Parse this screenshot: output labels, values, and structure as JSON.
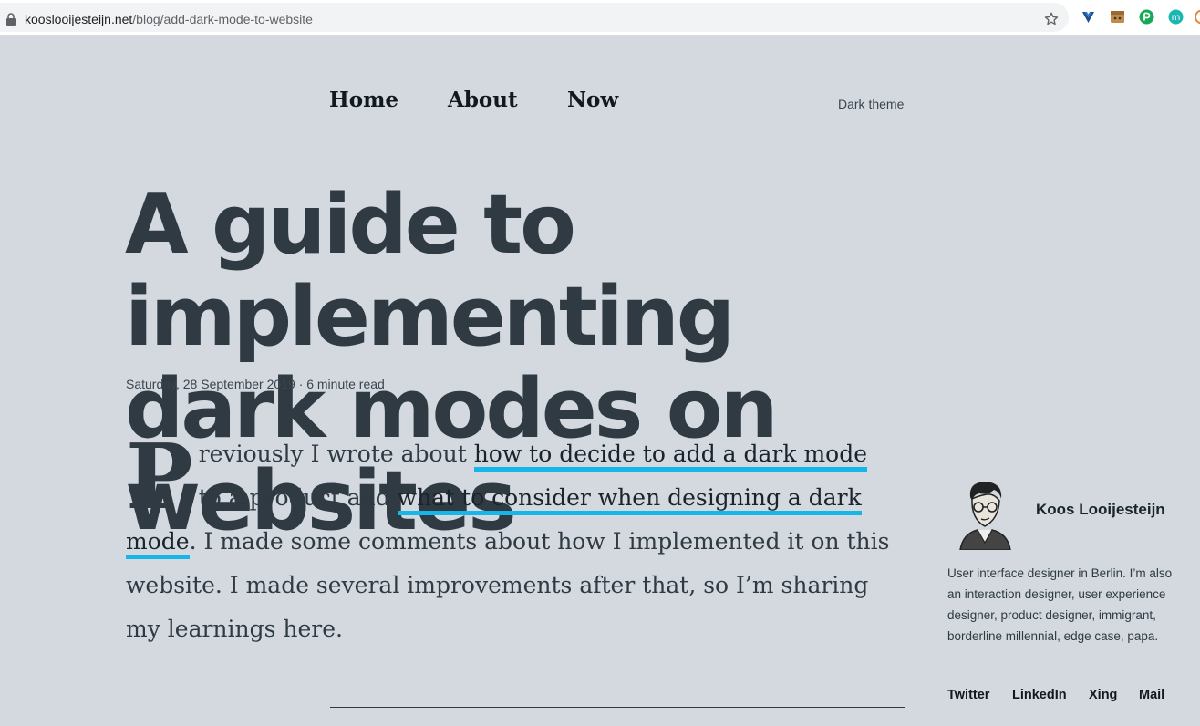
{
  "browser": {
    "url_domain": "kooslooijesteijn.net",
    "url_path": "/blog/add-dark-mode-to-website",
    "extension_icons": [
      "vue-devtools-icon",
      "box-extension-icon",
      "grammar-extension-icon",
      "m-extension-icon"
    ]
  },
  "nav": {
    "items": [
      {
        "label": "Home"
      },
      {
        "label": "About"
      },
      {
        "label": "Now"
      }
    ],
    "theme_toggle": "Dark theme"
  },
  "article": {
    "title_line1": "A guide to implementing",
    "title_line2": "dark modes on websites",
    "date": "Saturday, 28 September 2019",
    "separator": "·",
    "read_time": "6 minute read",
    "dropcap": "P",
    "intro_1": "reviously I wrote about ",
    "link_1": "how to decide to add a dark mode",
    "intro_2": " to a product and ",
    "link_2": "what to consider when designing a dark mode",
    "intro_3": ". I made some comments about how I implemented it on this website. I made several improvements after that, so I’m sharing my learnings here."
  },
  "author": {
    "name": "Koos Looijesteijn",
    "bio": "User interface designer in Berlin. I’m also an interaction designer, user experience designer, product designer, immigrant, borderline millennial, edge case, papa.",
    "links": [
      {
        "label": "Twitter"
      },
      {
        "label": "LinkedIn"
      },
      {
        "label": "Xing"
      },
      {
        "label": "Mail"
      }
    ]
  },
  "colors": {
    "background": "#d3d9df",
    "text": "#2f3a43",
    "link_underline": "#16b6e8"
  }
}
